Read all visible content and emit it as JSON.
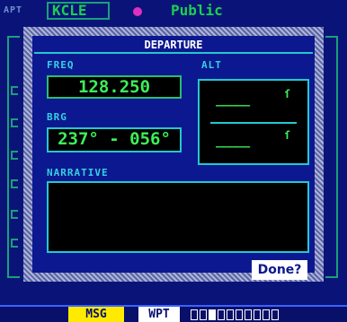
{
  "background_page": {
    "group_label": "APT",
    "identifier": "KCLE",
    "facility_type": "Public"
  },
  "dialog": {
    "title": "DEPARTURE",
    "freq_label": "FREQ",
    "freq_value": "128.250",
    "alt_label": "ALT",
    "alt_upper": "_____",
    "alt_upper_unit": "ft",
    "alt_lower": "_____",
    "alt_lower_unit": "ft",
    "brg_label": "BRG",
    "brg_value": "237° - 056°",
    "narrative_label": "NARRATIVE",
    "narrative_text": "",
    "done_label": "Done?"
  },
  "status_bar": {
    "msg_label": "MSG",
    "page_group": "WPT",
    "page_count": 10,
    "active_page": 2
  },
  "colors": {
    "background": "#08106a",
    "dialog": "#0c1890",
    "label": "#35d0e0",
    "value": "#3df05a",
    "msg": "#ffea00"
  }
}
